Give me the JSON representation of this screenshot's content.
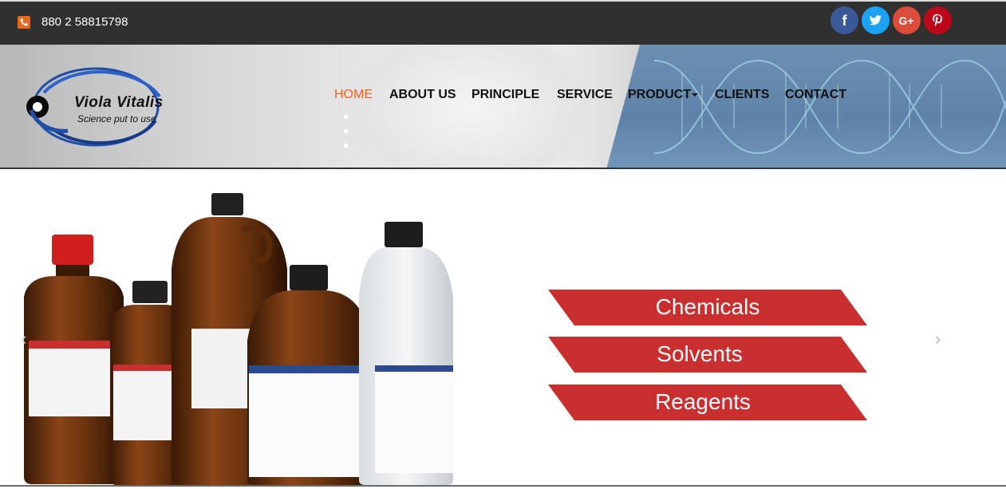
{
  "topbar": {
    "phone": "880 2 58815798"
  },
  "social": [
    {
      "name": "facebook-icon",
      "glyph": "f"
    },
    {
      "name": "twitter-icon"
    },
    {
      "name": "google-plus-icon",
      "glyph": "G+"
    },
    {
      "name": "pinterest-icon"
    }
  ],
  "logo": {
    "name": "Viola Vitalis",
    "tagline": "Science put to use"
  },
  "nav": {
    "home": "HOME",
    "about": "ABOUT US",
    "principle": "PRINCIPLE",
    "service": "SERVICE",
    "product": "PRODUCT",
    "clients": "CLIENTS",
    "contact": "CONTACT"
  },
  "slider": {
    "banners": [
      "Chemicals",
      "Solvents",
      "Reagents"
    ],
    "prev_glyph": "‹",
    "next_glyph": "›"
  },
  "colors": {
    "accent": "#ee6327",
    "banner": "#c92f2f",
    "topbar": "#303030"
  }
}
